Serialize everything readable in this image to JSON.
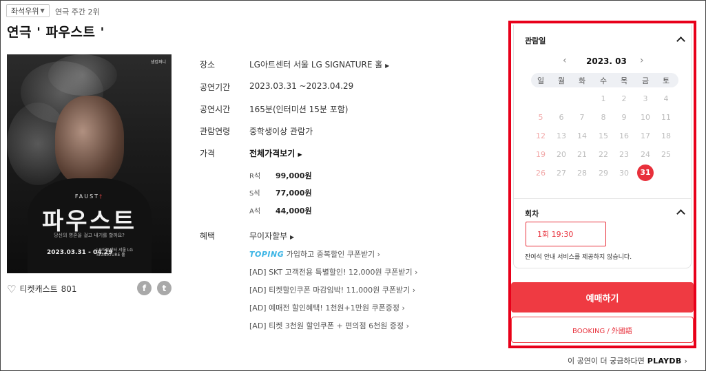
{
  "header": {
    "seat_badge": "좌석우위",
    "rank": "연극 주간 2위",
    "title": "연극 ' 파우스트 '"
  },
  "poster": {
    "corner_logo": "샘컴퍼니",
    "faust_en": "FAUST",
    "title_ko": "파우스트",
    "tagline": "당신의 영혼을 걸고 내기를 할까요?",
    "dates": "2023.03.31 - 04.29",
    "venue": "LG아트센터 서울 LG SIGNATURE 홀"
  },
  "cast": {
    "label": "티켓캐스트",
    "count": "801"
  },
  "social": [
    "f",
    "t"
  ],
  "info": [
    {
      "label": "장소",
      "value": "LG아트센터 서울 LG SIGNATURE 홀"
    },
    {
      "label": "공연기간",
      "value": "2023.03.31 ~2023.04.29"
    },
    {
      "label": "공연시간",
      "value": "165분(인터미션 15분 포함)"
    },
    {
      "label": "관람연령",
      "value": "중학생이상 관람가"
    },
    {
      "label": "가격",
      "value": "전체가격보기"
    }
  ],
  "prices": [
    {
      "seat": "R석",
      "price": "99,000원"
    },
    {
      "seat": "S석",
      "price": "77,000원"
    },
    {
      "seat": "A석",
      "price": "44,000원"
    }
  ],
  "benefit": {
    "label": "혜택",
    "title": "무이자할부",
    "toping_brand": "TOPING",
    "toping_text": "가입하고 중복할인 쿠폰받기",
    "ads": [
      "[AD] SKT 고객전용 특별할인! 12,000원 쿠폰받기",
      "[AD] 티켓할인쿠폰 마감임박! 11,000원 쿠폰받기",
      "[AD] 예매전 할인혜택! 1천원+1만원 쿠폰증정",
      "[AD] 티켓 3천원 할인쿠폰 + 편의점 6천원 증정"
    ]
  },
  "booking": {
    "date_title": "관람일",
    "month": "2023. 03",
    "weekdays": [
      "일",
      "월",
      "화",
      "수",
      "목",
      "금",
      "토"
    ],
    "weeks": [
      [
        "",
        "",
        "",
        "1",
        "2",
        "3",
        "4"
      ],
      [
        "5",
        "6",
        "7",
        "8",
        "9",
        "10",
        "11"
      ],
      [
        "12",
        "13",
        "14",
        "15",
        "16",
        "17",
        "18"
      ],
      [
        "19",
        "20",
        "21",
        "22",
        "23",
        "24",
        "25"
      ],
      [
        "26",
        "27",
        "28",
        "29",
        "30",
        "31",
        ""
      ]
    ],
    "selected_day": "31",
    "session_title": "회차",
    "session": "1회 19:30",
    "notice": "잔여석 안내 서비스를 제공하지 않습니다.",
    "book_button": "예매하기",
    "booking_en": "BOOKING / 外國語",
    "accent_color": "#e8303b"
  },
  "footer": {
    "more_text": "이 공연이 더 궁금하다면",
    "brand": "PLAYDB"
  }
}
